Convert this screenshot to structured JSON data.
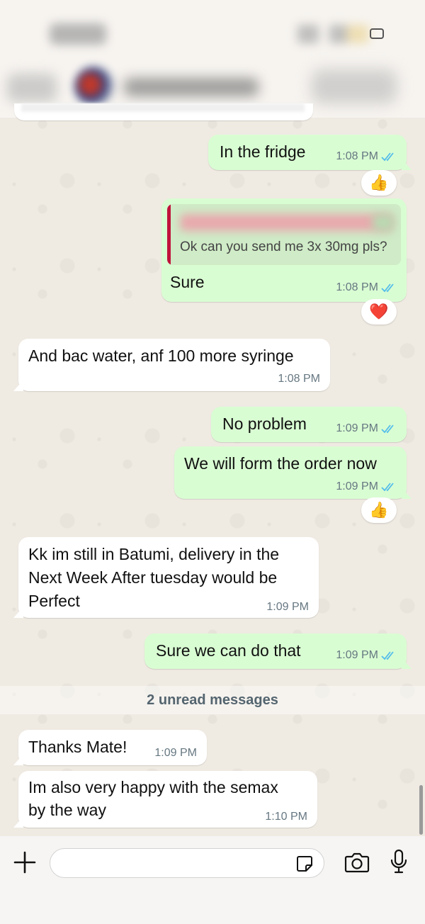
{
  "header": {
    "status_time": "",
    "contact_name": ""
  },
  "messages": [
    {
      "dir": "out",
      "text": "In the fridge",
      "time": "1:08 PM",
      "ticks": "read",
      "reaction": "👍"
    },
    {
      "dir": "out",
      "quote": "Ok can you send me 3x 30mg pls?",
      "text": "Sure",
      "time": "1:08 PM",
      "ticks": "read",
      "reaction": "❤️"
    },
    {
      "dir": "in",
      "text": "And bac water, anf 100 more syringe",
      "time": "1:08 PM"
    },
    {
      "dir": "out",
      "text": "No problem",
      "time": "1:09 PM",
      "ticks": "read"
    },
    {
      "dir": "out",
      "text": "We will form the order now",
      "time": "1:09 PM",
      "ticks": "read",
      "reaction": "👍"
    },
    {
      "dir": "in",
      "lines": [
        "Kk im still in Batumi, delivery in the",
        "Next Week After tuesday would be",
        "Perfect"
      ],
      "time": "1:09 PM"
    },
    {
      "dir": "out",
      "text": "Sure we can do that",
      "time": "1:09 PM",
      "ticks": "read"
    },
    {
      "dir": "in",
      "text": "Thanks Mate!",
      "time": "1:09 PM"
    },
    {
      "dir": "in",
      "lines": [
        "Im also very happy with the semax",
        "by the way"
      ],
      "time": "1:10 PM"
    }
  ],
  "unread_divider": "2 unread messages",
  "composer": {
    "placeholder": ""
  },
  "colors": {
    "outgoing_bubble": "#d9fdd3",
    "incoming_bubble": "#ffffff",
    "read_ticks": "#53bdeb",
    "wallpaper": "#efeae2"
  },
  "icons": [
    "plus-icon",
    "sticker-icon",
    "camera-icon",
    "microphone-icon",
    "double-check-icon"
  ]
}
